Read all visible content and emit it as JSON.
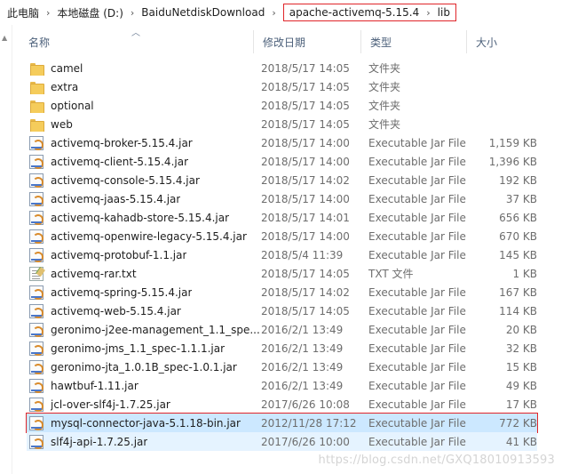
{
  "breadcrumb": {
    "items": [
      "此电脑",
      "本地磁盘 (D:)",
      "BaiduNetdiskDownload"
    ],
    "highlighted": [
      "apache-activemq-5.15.4",
      "lib"
    ],
    "separator": "›"
  },
  "columns": {
    "name": "名称",
    "date": "修改日期",
    "type": "类型",
    "size": "大小"
  },
  "files": [
    {
      "name": "camel",
      "date": "2018/5/17 14:05",
      "type": "文件夹",
      "size": "",
      "icon": "folder-icon"
    },
    {
      "name": "extra",
      "date": "2018/5/17 14:05",
      "type": "文件夹",
      "size": "",
      "icon": "folder-icon"
    },
    {
      "name": "optional",
      "date": "2018/5/17 14:05",
      "type": "文件夹",
      "size": "",
      "icon": "folder-icon"
    },
    {
      "name": "web",
      "date": "2018/5/17 14:05",
      "type": "文件夹",
      "size": "",
      "icon": "folder-icon"
    },
    {
      "name": "activemq-broker-5.15.4.jar",
      "date": "2018/5/17 14:00",
      "type": "Executable Jar File",
      "size": "1,159 KB",
      "icon": "jar-icon"
    },
    {
      "name": "activemq-client-5.15.4.jar",
      "date": "2018/5/17 14:00",
      "type": "Executable Jar File",
      "size": "1,396 KB",
      "icon": "jar-icon"
    },
    {
      "name": "activemq-console-5.15.4.jar",
      "date": "2018/5/17 14:02",
      "type": "Executable Jar File",
      "size": "192 KB",
      "icon": "jar-icon"
    },
    {
      "name": "activemq-jaas-5.15.4.jar",
      "date": "2018/5/17 14:00",
      "type": "Executable Jar File",
      "size": "37 KB",
      "icon": "jar-icon"
    },
    {
      "name": "activemq-kahadb-store-5.15.4.jar",
      "date": "2018/5/17 14:01",
      "type": "Executable Jar File",
      "size": "656 KB",
      "icon": "jar-icon"
    },
    {
      "name": "activemq-openwire-legacy-5.15.4.jar",
      "date": "2018/5/17 14:00",
      "type": "Executable Jar File",
      "size": "670 KB",
      "icon": "jar-icon"
    },
    {
      "name": "activemq-protobuf-1.1.jar",
      "date": "2018/5/4 11:39",
      "type": "Executable Jar File",
      "size": "145 KB",
      "icon": "jar-icon"
    },
    {
      "name": "activemq-rar.txt",
      "date": "2018/5/17 14:05",
      "type": "TXT 文件",
      "size": "1 KB",
      "icon": "txt-icon"
    },
    {
      "name": "activemq-spring-5.15.4.jar",
      "date": "2018/5/17 14:02",
      "type": "Executable Jar File",
      "size": "167 KB",
      "icon": "jar-icon"
    },
    {
      "name": "activemq-web-5.15.4.jar",
      "date": "2018/5/17 14:05",
      "type": "Executable Jar File",
      "size": "114 KB",
      "icon": "jar-icon"
    },
    {
      "name": "geronimo-j2ee-management_1.1_spe...",
      "date": "2016/2/1 13:49",
      "type": "Executable Jar File",
      "size": "20 KB",
      "icon": "jar-icon"
    },
    {
      "name": "geronimo-jms_1.1_spec-1.1.1.jar",
      "date": "2016/2/1 13:49",
      "type": "Executable Jar File",
      "size": "32 KB",
      "icon": "jar-icon"
    },
    {
      "name": "geronimo-jta_1.0.1B_spec-1.0.1.jar",
      "date": "2016/2/1 13:49",
      "type": "Executable Jar File",
      "size": "15 KB",
      "icon": "jar-icon"
    },
    {
      "name": "hawtbuf-1.11.jar",
      "date": "2016/2/1 13:49",
      "type": "Executable Jar File",
      "size": "49 KB",
      "icon": "jar-icon"
    },
    {
      "name": "jcl-over-slf4j-1.7.25.jar",
      "date": "2017/6/26 10:08",
      "type": "Executable Jar File",
      "size": "17 KB",
      "icon": "jar-icon"
    },
    {
      "name": "mysql-connector-java-5.1.18-bin.jar",
      "date": "2012/11/28 17:12",
      "type": "Executable Jar File",
      "size": "772 KB",
      "icon": "jar-icon",
      "state": "selected"
    },
    {
      "name": "slf4j-api-1.7.25.jar",
      "date": "2017/6/26 10:00",
      "type": "Executable Jar File",
      "size": "41 KB",
      "icon": "jar-icon",
      "state": "hover"
    }
  ],
  "watermark": "https://blog.csdn.net/GXQ18010913593",
  "colors": {
    "selected_bg": "#cce8ff",
    "hover_bg": "#e5f3ff",
    "highlight_box": "#e0252a",
    "header_text": "#4c607a",
    "meta_text": "#6d6d6d"
  }
}
